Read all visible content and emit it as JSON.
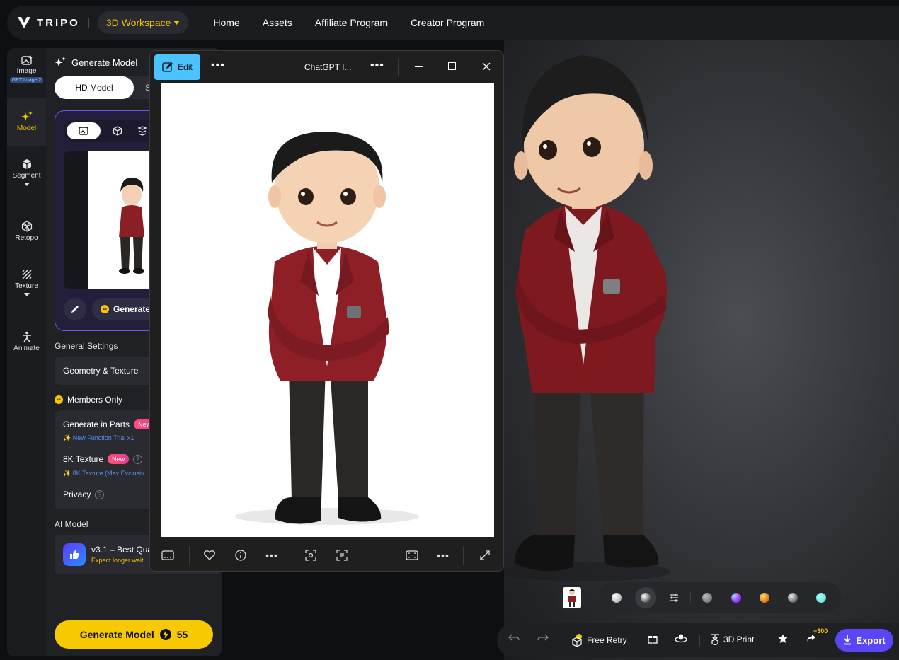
{
  "topbar": {
    "logo_text": "TRIPO",
    "workspace_label": "3D Workspace",
    "nav": [
      "Home",
      "Assets",
      "Affiliate Program",
      "Creator Program"
    ]
  },
  "rail": {
    "image_label": "Image",
    "image_badge": "GPT Image 2",
    "model_label": "Model",
    "segment_label": "Segment",
    "retopo_label": "Retopo",
    "texture_label": "Texture",
    "animate_label": "Animate"
  },
  "panel": {
    "title": "Generate Model",
    "mode_active": "HD Model",
    "mode_other": "S",
    "generate_small_label": "Generate",
    "general_settings_label": "General Settings",
    "geometry_label": "Geometry & Texture",
    "members_only_label": "Members Only",
    "parts_label": "Generate in Parts",
    "parts_badge": "New",
    "parts_sub": "New Function Trial x1",
    "texture8k_label": "8K Texture",
    "texture8k_badge": "New",
    "texture8k_sub": "8K Texture (Max Exclusiv",
    "privacy_label": "Privacy",
    "ai_model_label": "AI Model",
    "ai_model_name": "v3.1 – Best Qua",
    "ai_model_sub": "Expect longer wait",
    "generate_main_label": "Generate Model",
    "generate_cost": "55"
  },
  "viewer": {
    "edit_label": "Edit",
    "title": "ChatGPT I..."
  },
  "actions": {
    "free_retry_label": "Free Retry",
    "print_label": "3D Print",
    "plus_badge": "+300",
    "export_label": "Export"
  },
  "colors": {
    "accent": "#f7c900",
    "brand_purple": "#5b46f5",
    "viewer_edit": "#4cc2ff",
    "blazer": "#7e1a1f"
  }
}
